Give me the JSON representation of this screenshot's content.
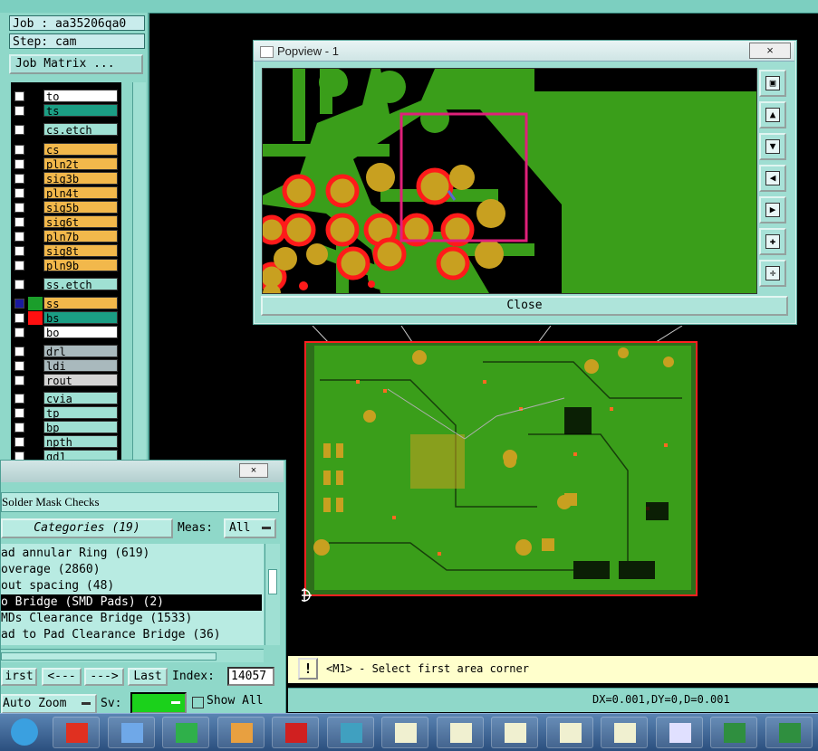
{
  "left_panel": {
    "job_label": "Job : aa35206qa0",
    "step_label": "Step: cam",
    "job_matrix_label": "Job Matrix ...",
    "layers": [
      {
        "name": "to",
        "row": 0,
        "color": "#ffffff",
        "swatch": "#000000",
        "checked": false
      },
      {
        "name": "ts",
        "row": 1,
        "color": "#1b9e84",
        "swatch": "#000000",
        "checked": false
      },
      {
        "name": "cs.etch",
        "row": 2.3,
        "color": "#9fe0d3",
        "swatch": "#000000",
        "checked": false
      },
      {
        "name": "cs",
        "row": 3.7,
        "color": "#f2b84b",
        "swatch": "#000000",
        "checked": false
      },
      {
        "name": "pln2t",
        "row": 4.7,
        "color": "#f2b84b",
        "swatch": "#000000",
        "checked": false
      },
      {
        "name": "sig3b",
        "row": 5.7,
        "color": "#f2b84b",
        "swatch": "#000000",
        "checked": false
      },
      {
        "name": "pln4t",
        "row": 6.7,
        "color": "#f2b84b",
        "swatch": "#000000",
        "checked": false
      },
      {
        "name": "sig5b",
        "row": 7.7,
        "color": "#f2b84b",
        "swatch": "#000000",
        "checked": false
      },
      {
        "name": "sig6t",
        "row": 8.7,
        "color": "#f2b84b",
        "swatch": "#000000",
        "checked": false
      },
      {
        "name": "pln7b",
        "row": 9.7,
        "color": "#f2b84b",
        "swatch": "#000000",
        "checked": false
      },
      {
        "name": "sig8t",
        "row": 10.7,
        "color": "#f2b84b",
        "swatch": "#000000",
        "checked": false
      },
      {
        "name": "pln9b",
        "row": 11.7,
        "color": "#f2b84b",
        "swatch": "#000000",
        "checked": false
      },
      {
        "name": "ss.etch",
        "row": 13,
        "color": "#9fe0d3",
        "swatch": "#000000",
        "checked": false
      },
      {
        "name": "ss",
        "row": 14.3,
        "color": "#f2b84b",
        "swatch": "#1b9e2b",
        "checked": true
      },
      {
        "name": "bs",
        "row": 15.3,
        "color": "#1b9e84",
        "swatch": "#ff1010",
        "checked": false
      },
      {
        "name": "bo",
        "row": 16.3,
        "color": "#ffffff",
        "swatch": "#000000",
        "checked": false
      },
      {
        "name": "drl",
        "row": 17.6,
        "color": "#a9b9bd",
        "swatch": "#000000",
        "checked": false
      },
      {
        "name": "ldi",
        "row": 18.6,
        "color": "#a9b9bd",
        "swatch": "#000000",
        "checked": false
      },
      {
        "name": "rout",
        "row": 19.6,
        "color": "#d4d4d4",
        "swatch": "#000000",
        "checked": false
      },
      {
        "name": "cvia",
        "row": 20.9,
        "color": "#9fe0d3",
        "swatch": "#000000",
        "checked": false
      },
      {
        "name": "tp",
        "row": 21.9,
        "color": "#9fe0d3",
        "swatch": "#000000",
        "checked": false
      },
      {
        "name": "bp",
        "row": 22.9,
        "color": "#9fe0d3",
        "swatch": "#000000",
        "checked": false
      },
      {
        "name": "npth",
        "row": 23.9,
        "color": "#9fe0d3",
        "swatch": "#000000",
        "checked": false
      },
      {
        "name": "gd1",
        "row": 24.9,
        "color": "#9fe0d3",
        "swatch": "#000000",
        "checked": false
      }
    ]
  },
  "popview": {
    "title": "Popview - 1",
    "close_x": "×",
    "close_label": "Close",
    "tools": [
      "fit-icon",
      "pan-up-icon",
      "pan-down-icon",
      "pan-left-icon",
      "pan-right-icon",
      "zoom-in-icon",
      "zoom-out-icon"
    ]
  },
  "solder_mask": {
    "close_x": "×",
    "header": "Solder Mask Checks",
    "categories_label": "Categories (19)",
    "meas_label": "Meas:",
    "meas_value": "All",
    "items": [
      "ad annular Ring (619)",
      "overage (2860)",
      "out spacing (48)",
      "o Bridge (SMD Pads) (2)",
      "MDs Clearance Bridge (1533)",
      "ad to Pad Clearance Bridge (36)"
    ],
    "selected_index": 3,
    "nav": {
      "first": "irst",
      "prev": "<---",
      "next": "--->",
      "last": "Last"
    },
    "index_label": "Index:",
    "index_value": "14057",
    "zoom_label": "Auto Zoom",
    "sv_label": "Sv:",
    "show_all_label": "Show All"
  },
  "message": {
    "icon": "!",
    "text": "<M1> - Select first area corner"
  },
  "status": {
    "coords": "DX=0.001,DY=0,D=0.001"
  },
  "taskbar": {
    "items": [
      "start-orb-icon",
      "genesis-icon",
      "notepad-icon",
      "frontline-icon",
      "shell-icon",
      "save-icon",
      "eye-viewer-icon",
      "cam-window-icon",
      "cam-window-icon",
      "cam-window-icon",
      "cam-window-icon",
      "cam-window-icon",
      "wordpad-icon",
      "excel-icon",
      "excel-icon"
    ]
  },
  "colors": {
    "panel": "#8fd8c9",
    "board_green": "#3a9e1a",
    "pad_gold": "#c8a020",
    "pad_red": "#ff1a1a",
    "selection_magenta": "#e0207a",
    "message_bg": "#ffffcc"
  }
}
